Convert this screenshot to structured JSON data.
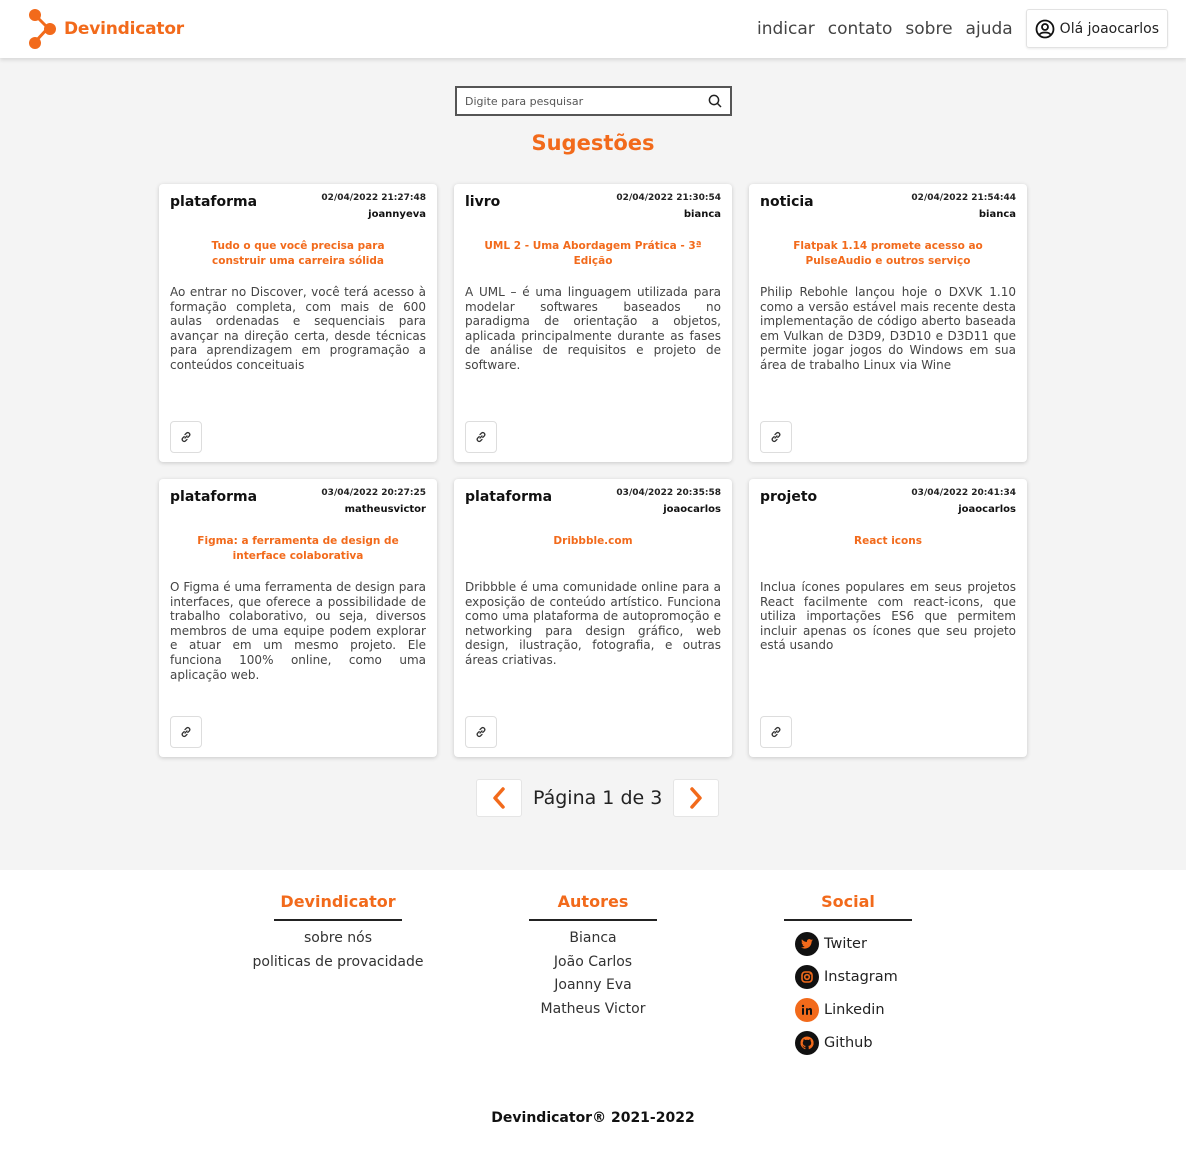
{
  "brand": {
    "name": "Devindicator",
    "accent": "#f26a1b"
  },
  "nav": {
    "links": [
      "indicar",
      "contato",
      "sobre",
      "ajuda"
    ],
    "user_label": "Olá joaocarlos"
  },
  "search": {
    "placeholder": "Digite para pesquisar"
  },
  "main": {
    "title": "Sugestões"
  },
  "cards": [
    {
      "category": "plataforma",
      "date": "02/04/2022 21:27:48",
      "author": "joannyeva",
      "title": "Tudo o que você precisa para construir uma carreira sólida",
      "description": "Ao entrar no Discover, você terá acesso à formação completa, com mais de 600 aulas ordenadas e sequenciais para avançar na direção certa, desde técnicas para aprendizagem em programação a conteúdos conceituais"
    },
    {
      "category": "livro",
      "date": "02/04/2022 21:30:54",
      "author": "bianca",
      "title": "UML 2 - Uma Abordagem Prática - 3ª Edição",
      "description": "A UML – é uma linguagem utilizada para modelar softwares baseados no paradigma de orientação a objetos, aplicada principalmente durante as fases de análise de requisitos e projeto de software."
    },
    {
      "category": "noticia",
      "date": "02/04/2022 21:54:44",
      "author": "bianca",
      "title": "Flatpak 1.14 promete acesso ao PulseAudio e outros serviço",
      "description": "Philip Rebohle lançou hoje o DXVK 1.10 como a versão estável mais recente desta implementação de código aberto baseada em Vulkan de D3D9, D3D10 e D3D11 que permite jogar jogos do Windows em sua área de trabalho Linux via Wine"
    },
    {
      "category": "plataforma",
      "date": "03/04/2022 20:27:25",
      "author": "matheusvictor",
      "title": "Figma: a ferramenta de design de interface colaborativa",
      "description": "O Figma é uma ferramenta de design para interfaces, que oferece a possibilidade de trabalho colaborativo, ou seja, diversos membros de uma equipe podem explorar e atuar em um mesmo projeto. Ele funciona 100% online, como uma aplicação web."
    },
    {
      "category": "plataforma",
      "date": "03/04/2022 20:35:58",
      "author": "joaocarlos",
      "title": "Dribbble.com",
      "description": "Dribbble é uma comunidade online para a exposição de conteúdo artístico. Funciona como uma plataforma de autopromoção e networking para design gráfico, web design, ilustração, fotografia, e outras áreas criativas."
    },
    {
      "category": "projeto",
      "date": "03/04/2022 20:41:34",
      "author": "joaocarlos",
      "title": "React icons",
      "description": "Inclua ícones populares em seus projetos React facilmente com react-icons, que utiliza importações ES6 que permitem incluir apenas os ícones que seu projeto está usando"
    }
  ],
  "pagination": {
    "label": "Página 1 de 3"
  },
  "footer": {
    "col1": {
      "title": "Devindicator",
      "links": [
        "sobre nós",
        "politicas de provacidade"
      ]
    },
    "col2": {
      "title": "Autores",
      "links": [
        "Bianca",
        "João Carlos",
        "Joanny Eva",
        "Matheus Victor"
      ]
    },
    "col3": {
      "title": "Social",
      "links": [
        {
          "label": "Twiter",
          "icon": "twitter-icon"
        },
        {
          "label": "Instagram",
          "icon": "instagram-icon"
        },
        {
          "label": "Linkedin",
          "icon": "linkedin-icon"
        },
        {
          "label": "Github",
          "icon": "github-icon"
        }
      ]
    },
    "copyright": "Devindicator® 2021-2022"
  }
}
